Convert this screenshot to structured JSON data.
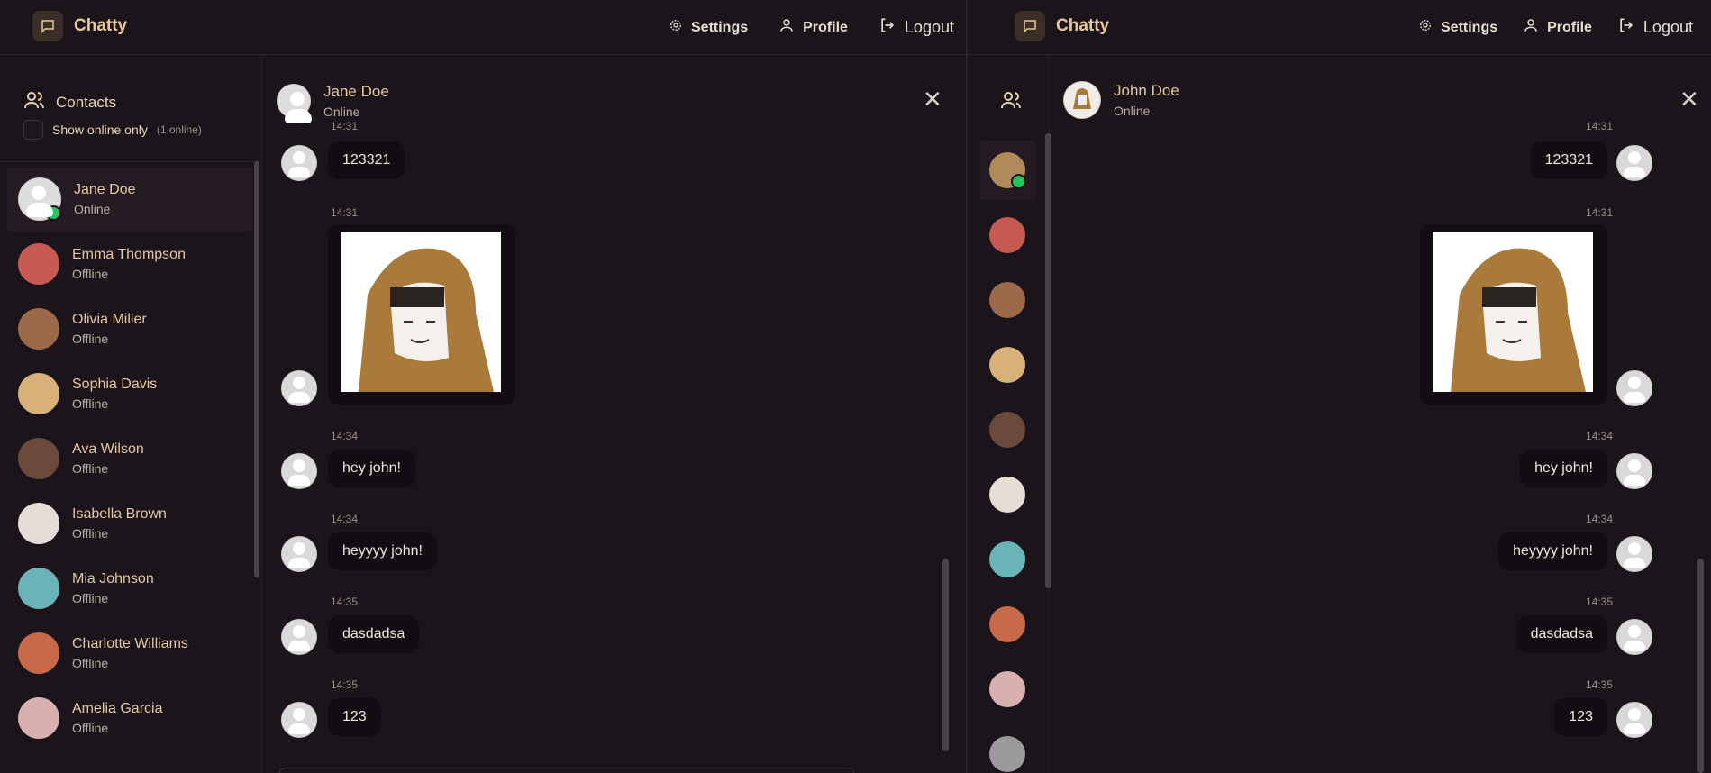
{
  "app": {
    "name": "Chatty"
  },
  "nav": {
    "settings": "Settings",
    "profile": "Profile",
    "logout": "Logout"
  },
  "colors": {
    "accent": "#e3c8a2",
    "background": "#1b141a",
    "bubble": "#120d12",
    "online": "#22c55e"
  },
  "left": {
    "sidebar": {
      "title": "Contacts",
      "filter_label": "Show online only",
      "online_count": "(1 online)",
      "contacts": [
        {
          "name": "Jane Doe",
          "status": "Online",
          "active": true,
          "online": true,
          "avatar": "default"
        },
        {
          "name": "Emma Thompson",
          "status": "Offline",
          "avatar": "#c65a52"
        },
        {
          "name": "Olivia Miller",
          "status": "Offline",
          "avatar": "#9a6a4a"
        },
        {
          "name": "Sophia Davis",
          "status": "Offline",
          "avatar": "#d8b07a"
        },
        {
          "name": "Ava Wilson",
          "status": "Offline",
          "avatar": "#6a4a3a"
        },
        {
          "name": "Isabella Brown",
          "status": "Offline",
          "avatar": "#e8dcd6"
        },
        {
          "name": "Mia Johnson",
          "status": "Offline",
          "avatar": "#6ab3b6"
        },
        {
          "name": "Charlotte Williams",
          "status": "Offline",
          "avatar": "#c86a4a"
        },
        {
          "name": "Amelia Garcia",
          "status": "Offline",
          "avatar": "#d8b0b0"
        }
      ]
    },
    "chat": {
      "name": "Jane Doe",
      "status": "Online",
      "messages": [
        {
          "time": "14:31",
          "text": "123321"
        },
        {
          "time": "14:31",
          "image": true
        },
        {
          "time": "14:34",
          "text": "hey john!"
        },
        {
          "time": "14:34",
          "text": "heyyyy john!"
        },
        {
          "time": "14:35",
          "text": "dasdadsa"
        },
        {
          "time": "14:35",
          "text": "123"
        }
      ]
    }
  },
  "right": {
    "chat": {
      "name": "John Doe",
      "status": "Online",
      "messages": [
        {
          "time": "14:31",
          "text": "123321"
        },
        {
          "time": "14:31",
          "image": true
        },
        {
          "time": "14:34",
          "text": "hey john!"
        },
        {
          "time": "14:34",
          "text": "heyyyy john!"
        },
        {
          "time": "14:35",
          "text": "dasdadsa"
        },
        {
          "time": "14:35",
          "text": "123"
        }
      ]
    },
    "rail_avatars": [
      "#b08a5a",
      "#c65a52",
      "#9a6a4a",
      "#d8b07a",
      "#6a4a3a",
      "#e8dcd6",
      "#6ab3b6",
      "#c86a4a",
      "#d8b0b0",
      "#9a9a9a"
    ]
  }
}
